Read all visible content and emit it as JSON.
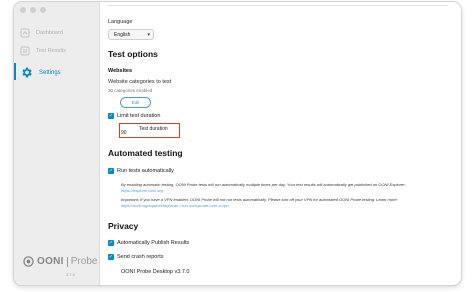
{
  "sidebar": {
    "items": [
      {
        "label": "Dashboard",
        "icon": "dashboard-icon"
      },
      {
        "label": "Test Results",
        "icon": "test-results-icon"
      },
      {
        "label": "Settings",
        "icon": "gear-icon"
      }
    ],
    "active_index": 2,
    "logo": {
      "word": "OONI",
      "sub": "Probe"
    },
    "version": "3.7.0"
  },
  "settings": {
    "language": {
      "label": "Language",
      "value": "English"
    },
    "test_options": {
      "heading": "Test options",
      "websites_heading": "Websites",
      "categories_label": "Website categories to test",
      "categories_count": "30 categories enabled",
      "edit_label": "Edit",
      "limit_duration_label": "Limit test duration",
      "limit_duration_checked": true,
      "duration_label": "Test duration",
      "duration_value": "90"
    },
    "automated": {
      "heading": "Automated testing",
      "run_auto_label": "Run tests automatically",
      "run_auto_checked": true,
      "explain_text": "By enabling automatic testing, OONI Probe tests will run automatically multiple times per day. Your test results will automatically get published on OONI Explorer:",
      "explain_link": "https://explorer.ooni.org",
      "important_text": "Important: If you have a VPN enabled, OONI Probe will not run tests automatically. Please turn off your VPN for automated OONI Probe testing. Learn more:",
      "important_link": "https://ooni.org/support/faq/#can-i-run-ooni-probe-over-a-vpn"
    },
    "privacy": {
      "heading": "Privacy",
      "publish_label": "Automatically Publish Results",
      "publish_checked": true,
      "crash_label": "Send crash reports",
      "crash_checked": true,
      "version_text": "OONI Probe Desktop v3.7.0"
    }
  },
  "colors": {
    "accent": "#0588cb",
    "highlight_box": "#d0421b",
    "sidebar_bg": "#ededed"
  }
}
